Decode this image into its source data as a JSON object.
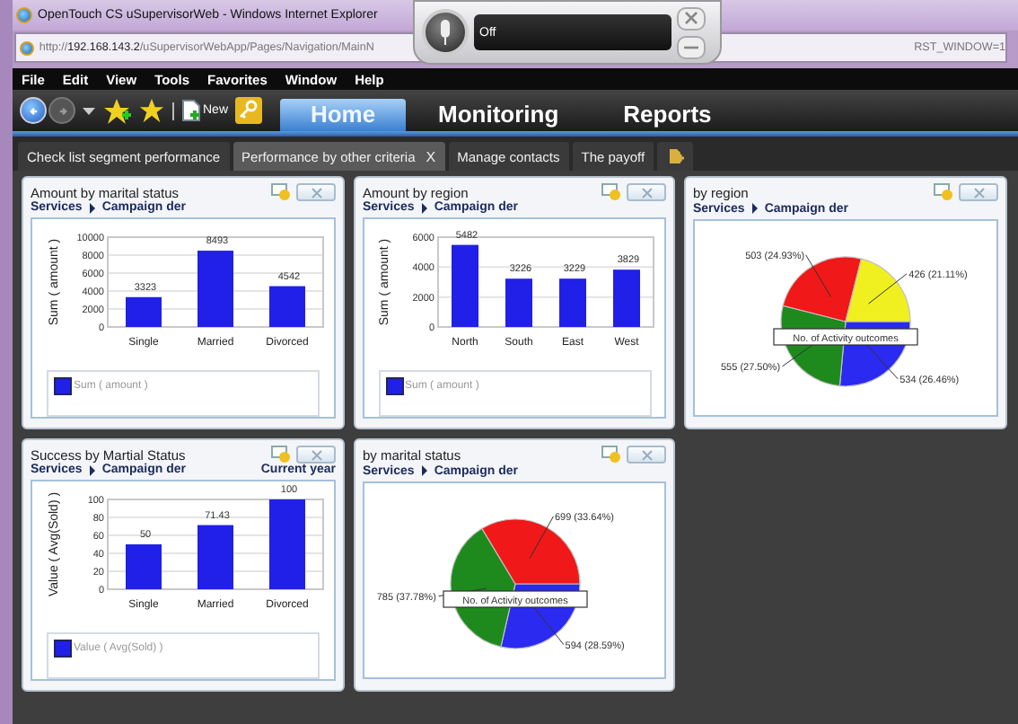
{
  "window": {
    "title": "OpenTouch CS uSupervisorWeb - Windows Internet Explorer"
  },
  "address_bar": {
    "url_start": "http://**192.168.143.2**/uSupervisorWebApp/Pages/Navigation/MainN",
    "url_end": "RST_WINDOW=1"
  },
  "voice_popup": {
    "status": "Off"
  },
  "menu": [
    "File",
    "Edit",
    "View",
    "Tools",
    "Favorites",
    "Window",
    "Help"
  ],
  "toolbar": {
    "new_button": "New"
  },
  "nav_tabs": [
    {
      "label": "Home",
      "selected": true
    },
    {
      "label": "Monitoring",
      "selected": false
    },
    {
      "label": "Reports",
      "selected": false
    }
  ],
  "page_tabs": [
    {
      "kind": "text",
      "label": "Check list segment performance",
      "selected": false,
      "closable": false
    },
    {
      "kind": "text",
      "label": "Performance by other criteria",
      "selected": true,
      "closable": true,
      "close": "X"
    },
    {
      "kind": "text",
      "label": "Manage contacts",
      "selected": false,
      "closable": false
    },
    {
      "kind": "text",
      "label": "The payoff",
      "selected": false,
      "closable": false
    },
    {
      "kind": "icon",
      "selected": false,
      "closable": false
    }
  ],
  "widgets": [
    {
      "title": "Amount by marital status",
      "breadcrumb": [
        "Services",
        "Campaign der"
      ],
      "chart_data": {
        "type": "bar",
        "ylabel": "Sum ( amount )",
        "categories": [
          "Single",
          "Married",
          "Divorced"
        ],
        "series": [
          {
            "name": "Sum ( amount )",
            "color": "#2020e8",
            "values": [
              3323,
              8493,
              4542
            ]
          }
        ],
        "ylim": [
          0,
          10000
        ],
        "yticks": [
          0,
          2000,
          4000,
          6000,
          8000,
          10000
        ],
        "grid": true,
        "data_labels": true
      }
    },
    {
      "title": "Amount by region",
      "breadcrumb": [
        "Services",
        "Campaign der"
      ],
      "chart_data": {
        "type": "bar",
        "ylabel": "Sum ( amount )",
        "categories": [
          "North",
          "South",
          "East",
          "West"
        ],
        "series": [
          {
            "name": "Sum ( amount )",
            "color": "#2020e8",
            "values": [
              5482,
              3226,
              3229,
              3829
            ]
          }
        ],
        "ylim": [
          0,
          6000
        ],
        "yticks": [
          0,
          2000,
          4000,
          6000
        ],
        "grid": true,
        "data_labels": true
      }
    },
    {
      "title": "by region",
      "breadcrumb": [
        "Services",
        "Campaign der"
      ],
      "chart_data": {
        "type": "pie",
        "series": [
          {
            "name": "No. of Activity outcomes",
            "values": [
              26.46,
              27.5,
              24.93,
              21.11
            ]
          }
        ],
        "colors": [
          "#2a2af0",
          "#1e8a1e",
          "#f01818",
          "#f0f020"
        ],
        "value_labels": [
          "534 (26.46%)",
          "555 (27.50%)",
          "503 (24.93%)",
          "426 (21.11%)"
        ]
      }
    },
    {
      "title": "Success by Martial Status",
      "breadcrumb": [
        "Services",
        "Campaign der"
      ],
      "period": "Current year",
      "chart_data": {
        "type": "bar",
        "ylabel": "Value ( Avg(Sold) )",
        "categories": [
          "Single",
          "Married",
          "Divorced"
        ],
        "series": [
          {
            "name": "Value ( Avg(Sold) )",
            "color": "#2020e8",
            "values": [
              50,
              71.43,
              100
            ]
          }
        ],
        "ylim": [
          0,
          100
        ],
        "yticks": [
          0,
          20,
          40,
          60,
          80,
          100
        ],
        "grid": true,
        "data_labels": true
      }
    },
    {
      "title": "by marital status",
      "breadcrumb": [
        "Services",
        "Campaign der"
      ],
      "chart_data": {
        "type": "pie",
        "series": [
          {
            "name": "No. of Activity outcomes",
            "values": [
              28.59,
              37.78,
              33.63
            ]
          }
        ],
        "colors": [
          "#2a2af0",
          "#1e8a1e",
          "#f01818"
        ],
        "value_labels": [
          "594 (28.59%)",
          "785 (37.78%)",
          "699 (33.64%)"
        ]
      }
    }
  ]
}
